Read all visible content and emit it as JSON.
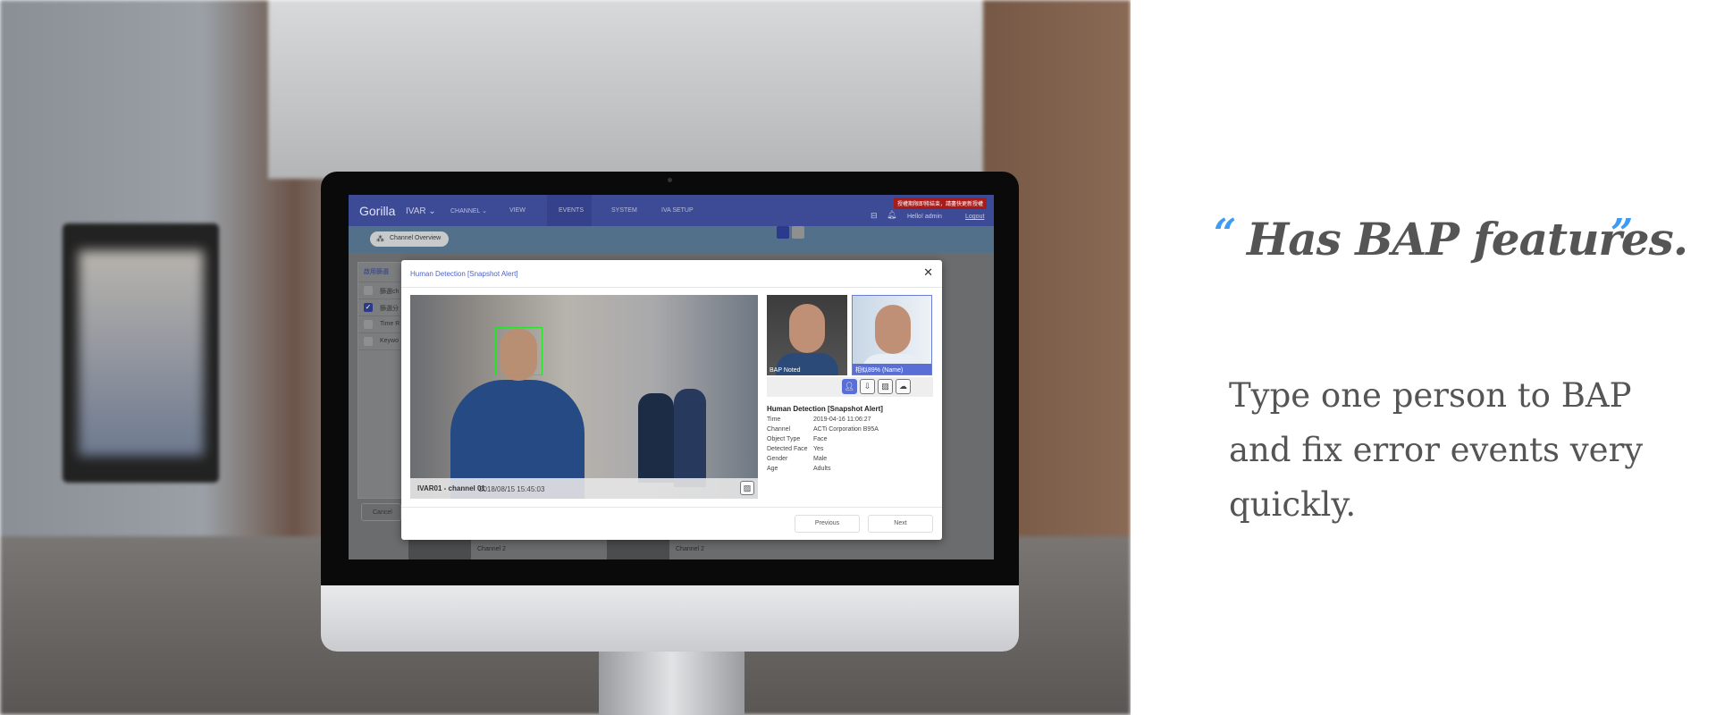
{
  "marketing": {
    "open_quote": "“",
    "headline": "Has BAP features.",
    "close_quote": "”",
    "body": "Type one person to BAP and fix error events very quickly.",
    "accent_color": "#3d9bf5"
  },
  "app": {
    "logo": "Gorilla",
    "product": "IVAR ⌄",
    "nav": [
      "CHANNEL ⌄",
      "VIEW",
      "EVENTS",
      "SYSTEM",
      "IVA SETUP"
    ],
    "license_warning": "授權期限即將結束，請盡快更新授權",
    "greeting": "Hello! admin",
    "logout": "Logout",
    "channel_overview": "Channel Overview",
    "filter": {
      "title": "啟用篩選",
      "items": [
        {
          "label": "篩選ch",
          "checked": false
        },
        {
          "label": "篩選分",
          "checked": true
        },
        {
          "label": "Time R",
          "checked": false
        },
        {
          "label": "Keywo",
          "checked": false
        }
      ],
      "cancel": "Cancel"
    },
    "tiles": [
      "Channel 2",
      "Channel 2"
    ]
  },
  "modal": {
    "title": "Human Detection [Snapshot Alert]",
    "close": "✕",
    "snapshot": {
      "channel": "IVAR01 - channel 01",
      "timestamp": "2018/08/15 15:45:03"
    },
    "face_left_label": "BAP Noted",
    "face_right_label": "相似89%  (Name)",
    "details": {
      "title": "Human Detection [Snapshot Alert]",
      "rows": [
        {
          "k": "Time",
          "v": "2019-04-16 11:06:27"
        },
        {
          "k": "Channel",
          "v": "ACTi Corporation B95A"
        },
        {
          "k": "Object Type",
          "v": "Face"
        },
        {
          "k": "Detected Face",
          "v": "Yes"
        },
        {
          "k": "Gender",
          "v": "Male"
        },
        {
          "k": "Age",
          "v": "Adults"
        }
      ]
    },
    "previous": "Previous",
    "next": "Next"
  }
}
